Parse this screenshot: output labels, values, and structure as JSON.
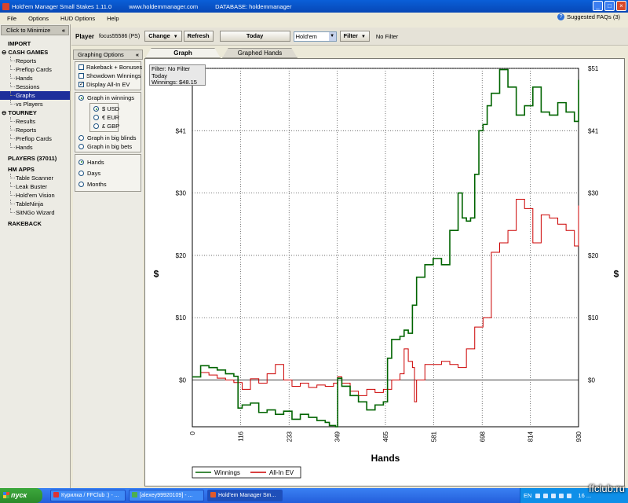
{
  "window": {
    "title": "Hold'em Manager Small Stakes 1.11.0",
    "site": "www.holdemmanager.com",
    "database": "DATABASE: holdemmanager"
  },
  "menu": {
    "items": [
      "File",
      "Options",
      "HUD Options",
      "Help"
    ],
    "faq": "Suggested FAQs (3)"
  },
  "nav": {
    "minimize": "Click to Minimize",
    "import": "IMPORT",
    "cash_games": "CASH GAMES",
    "cash_items": [
      "Reports",
      "Preflop Cards",
      "Hands",
      "Sessions",
      "Graphs",
      "vs Players"
    ],
    "tourney": "TOURNEY",
    "tourney_items": [
      "Results",
      "Reports",
      "Preflop Cards",
      "Hands"
    ],
    "players": "PLAYERS (37011)",
    "hm_apps": "HM APPS",
    "app_items": [
      "Table Scanner",
      "Leak Buster",
      "Hold'em Vision",
      "TableNinja",
      "SitNGo Wizard"
    ],
    "rakeback": "RAKEBACK"
  },
  "toolbar": {
    "player_label": "Player",
    "player_name": "focus55586 (PS)",
    "change": "Change",
    "refresh": "Refresh",
    "today": "Today",
    "game": "Hold'em",
    "filter": "Filter",
    "filter_status": "No Filter"
  },
  "options": {
    "title": "Graphing Options",
    "checks": [
      {
        "label": "Rakeback + Bonuses",
        "checked": false
      },
      {
        "label": "Showdown Winnings",
        "checked": false
      },
      {
        "label": "Display All-In EV",
        "checked": true
      }
    ],
    "graph_in": [
      {
        "label": "Graph in winnings",
        "on": true
      },
      {
        "label": "Graph in big blinds",
        "on": false
      },
      {
        "label": "Graph in big bets",
        "on": false
      }
    ],
    "currencies": [
      {
        "label": "$ USD",
        "on": true
      },
      {
        "label": "€ EUR",
        "on": false
      },
      {
        "label": "£ GBP",
        "on": false
      }
    ],
    "x_units": [
      {
        "label": "Hands",
        "on": true
      },
      {
        "label": "Days",
        "on": false
      },
      {
        "label": "Months",
        "on": false
      }
    ]
  },
  "tabs": [
    "Graph",
    "Graphed Hands"
  ],
  "filter_box": {
    "line1": "Filter: No Filter",
    "line2": "Today",
    "line3": "Winnings: $48.15"
  },
  "chart_data": {
    "type": "line",
    "xlabel": "Hands",
    "ylabel": "$",
    "x_ticks": [
      0,
      116,
      233,
      349,
      465,
      581,
      698,
      814,
      930
    ],
    "y_ticks": [
      "$0",
      "$10",
      "$20",
      "$30",
      "$41",
      "$51"
    ],
    "y_tick_values": [
      0,
      10,
      20,
      30,
      40,
      50
    ],
    "xlim": [
      0,
      930
    ],
    "ylim": [
      -7.5,
      50
    ],
    "grid": true,
    "legend_position": "bottom-left",
    "series": [
      {
        "name": "Winnings",
        "color": "#006400",
        "x": [
          0,
          20,
          40,
          60,
          80,
          100,
          110,
          120,
          140,
          160,
          180,
          200,
          220,
          240,
          260,
          280,
          300,
          320,
          330,
          345,
          350,
          360,
          380,
          400,
          420,
          440,
          460,
          470,
          480,
          500,
          510,
          520,
          530,
          540,
          560,
          580,
          600,
          620,
          640,
          650,
          660,
          670,
          680,
          690,
          700,
          710,
          720,
          740,
          760,
          780,
          800,
          820,
          840,
          860,
          880,
          900,
          920,
          930
        ],
        "y": [
          0.5,
          2.3,
          2.0,
          1.6,
          1.0,
          0.6,
          -4.5,
          -4.0,
          -3.7,
          -5.2,
          -4.8,
          -5.5,
          -5.0,
          -6.3,
          -5.5,
          -6.0,
          -6.5,
          -6.8,
          -7.3,
          -7.5,
          0.3,
          -1.0,
          -2.5,
          -3.5,
          -4.8,
          -4.0,
          -3.5,
          3.5,
          6.5,
          7.0,
          8.0,
          7.5,
          12.0,
          16.5,
          18.5,
          19.5,
          18.5,
          24.0,
          30.0,
          26.0,
          25.5,
          26.0,
          33.0,
          40.0,
          41.0,
          44.0,
          46.0,
          49.8,
          47.0,
          42.5,
          44.0,
          47.0,
          43.0,
          42.5,
          44.5,
          43.0,
          41.5,
          48.15
        ]
      },
      {
        "name": "All-In EV",
        "color": "#cc0000",
        "x": [
          0,
          20,
          40,
          60,
          80,
          100,
          120,
          140,
          160,
          180,
          200,
          220,
          240,
          260,
          280,
          300,
          320,
          340,
          350,
          360,
          380,
          400,
          420,
          440,
          460,
          480,
          500,
          510,
          520,
          530,
          535,
          540,
          560,
          580,
          600,
          620,
          640,
          660,
          680,
          700,
          720,
          740,
          760,
          780,
          800,
          820,
          840,
          860,
          880,
          900,
          920,
          930
        ],
        "y": [
          0.5,
          1.2,
          0.8,
          0.3,
          0.0,
          -0.4,
          -1.5,
          0.2,
          -0.5,
          1.0,
          2.5,
          0.0,
          -1.0,
          -0.5,
          -1.2,
          -0.8,
          -1.0,
          -0.5,
          0.5,
          -0.5,
          -1.8,
          -2.5,
          -1.5,
          -2.0,
          -1.5,
          0.0,
          1.0,
          5.0,
          3.0,
          2.0,
          -3.5,
          0.0,
          2.5,
          2.5,
          3.0,
          2.5,
          2.0,
          5.0,
          8.5,
          10.0,
          20.5,
          22.0,
          24.0,
          29.0,
          27.5,
          22.0,
          26.5,
          26.0,
          25.0,
          24.0,
          21.5,
          28.0
        ]
      }
    ]
  },
  "taskbar": {
    "start": "пуск",
    "tasks": [
      "Курилка / FFClub :) - ...",
      "[alexey99920109] - ...",
      "Hold'em Manager Sm..."
    ],
    "lang": "EN",
    "clock": "16 ...",
    "watermark": "ffclub.ru"
  }
}
